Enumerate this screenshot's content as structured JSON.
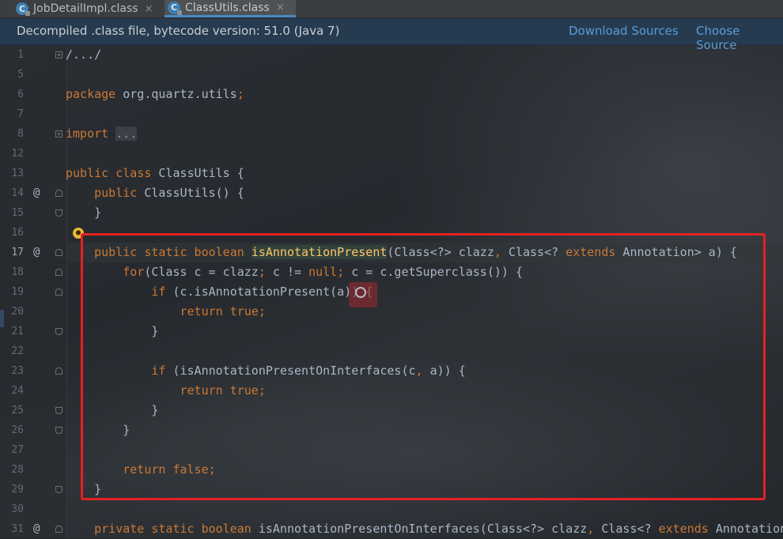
{
  "tabs": [
    {
      "label": "JobDetailImpl.class",
      "icon": "C",
      "close": "×",
      "active": false
    },
    {
      "label": "ClassUtils.class",
      "icon": "C",
      "close": "×",
      "active": true
    }
  ],
  "banner": {
    "message": "Decompiled .class file, bytecode version: 51.0 (Java 7)",
    "download_sources": "Download Sources",
    "choose_sources": "Choose Source"
  },
  "editor": {
    "current_line": "17",
    "lines": [
      {
        "n": "1"
      },
      {
        "n": "5"
      },
      {
        "n": "6"
      },
      {
        "n": "7"
      },
      {
        "n": "8"
      },
      {
        "n": "12"
      },
      {
        "n": "13"
      },
      {
        "n": "14"
      },
      {
        "n": "15"
      },
      {
        "n": "16"
      },
      {
        "n": "17"
      },
      {
        "n": "18"
      },
      {
        "n": "19"
      },
      {
        "n": "20"
      },
      {
        "n": "21"
      },
      {
        "n": "22"
      },
      {
        "n": "23"
      },
      {
        "n": "24"
      },
      {
        "n": "25"
      },
      {
        "n": "26"
      },
      {
        "n": "27"
      },
      {
        "n": "28"
      },
      {
        "n": "29"
      },
      {
        "n": "30"
      },
      {
        "n": "31"
      }
    ],
    "annotations": {
      "l14": "@",
      "l17": "@",
      "l31": "@"
    },
    "code": {
      "l1": "/.../",
      "l6_kw": "package",
      "l6_rest": " org.quartz.utils",
      "l6_semi": ";",
      "l8_kw": "import",
      "l8_dots": "...",
      "l13_kw": "public class",
      "l13_rest": " ClassUtils {",
      "l14_kw": "public",
      "l14_rest": " ClassUtils() {",
      "l15": "}",
      "l17_kw": "public static boolean",
      "l17_fn": "isAnnotationPresent",
      "l17_a": "(Class<?> clazz",
      "l17_comma": ",",
      "l17_b": " Class<? ",
      "l17_kw2": "extends",
      "l17_c": " Annotation> a) {",
      "l18_kw": "for",
      "l18_a": "(Class c = clazz",
      "l18_semi1": ";",
      "l18_b": " c != ",
      "l18_null": "null",
      "l18_semi2": ";",
      "l18_c": " c = c.getSuperclass()) {",
      "l19_kw": "if",
      "l19_rest": " (c.isAnnotationPresent(a)) {",
      "l20_kw": "return true",
      "l20_semi": ";",
      "l21": "}",
      "l23_kw": "if",
      "l23_a": " (isAnnotationPresentOnInterfaces(c",
      "l23_comma": ",",
      "l23_b": " a)) {",
      "l24_kw": "return true",
      "l24_semi": ";",
      "l25": "}",
      "l26": "}",
      "l28_kw": "return false",
      "l28_semi": ";",
      "l29": "}",
      "l31_kw": "private static boolean",
      "l31_a": " isAnnotationPresentOnInterfaces(Class<?> clazz",
      "l31_comma": ",",
      "l31_b": " Class<? ",
      "l31_kw2": "extends",
      "l31_c": " Annotation"
    }
  },
  "colors": {
    "keyword": "#cc7832",
    "method_decl": "#ffc66d",
    "text": "#a9b7c6",
    "highlight_box": "#e32222",
    "link": "#5a9bd8"
  }
}
